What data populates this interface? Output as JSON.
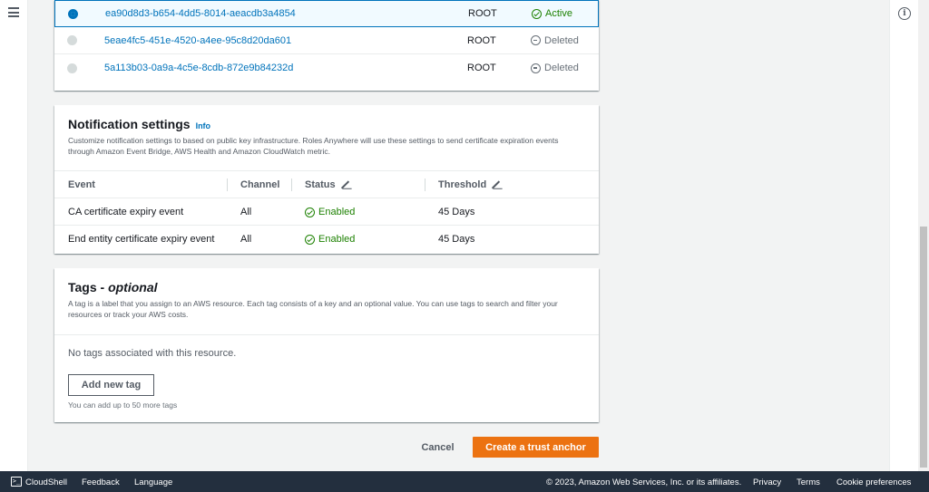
{
  "certificates": {
    "rows": [
      {
        "id": "ea90d8d3-b654-4dd5-8014-aeacdb3a4854",
        "type": "ROOT",
        "status": "Active",
        "selected": true
      },
      {
        "id": "5eae4fc5-451e-4520-a4ee-95c8d20da601",
        "type": "ROOT",
        "status": "Deleted",
        "selected": false
      },
      {
        "id": "5a113b03-0a9a-4c5e-8cdb-872e9b84232d",
        "type": "ROOT",
        "status": "Deleted",
        "selected": false
      }
    ]
  },
  "notification": {
    "title": "Notification settings",
    "info": "Info",
    "description": "Customize notification settings to based on public key infrastructure. Roles Anywhere will use these settings to send certificate expiration events through Amazon Event Bridge, AWS Health and Amazon CloudWatch metric.",
    "headers": {
      "event": "Event",
      "channel": "Channel",
      "status": "Status",
      "threshold": "Threshold"
    },
    "rows": [
      {
        "event": "CA certificate expiry event",
        "channel": "All",
        "status": "Enabled",
        "threshold": "45 Days"
      },
      {
        "event": "End entity certificate expiry event",
        "channel": "All",
        "status": "Enabled",
        "threshold": "45 Days"
      }
    ]
  },
  "tags": {
    "title": "Tags - ",
    "title_optional": "optional",
    "description": "A tag is a label that you assign to an AWS resource. Each tag consists of a key and an optional value. You can use tags to search and filter your resources or track your AWS costs.",
    "empty": "No tags associated with this resource.",
    "add_button": "Add new tag",
    "hint": "You can add up to 50 more tags"
  },
  "actions": {
    "cancel": "Cancel",
    "create": "Create a trust anchor"
  },
  "footer": {
    "cloudshell": "CloudShell",
    "feedback": "Feedback",
    "language": "Language",
    "copyright": "© 2023, Amazon Web Services, Inc. or its affiliates.",
    "privacy": "Privacy",
    "terms": "Terms",
    "cookies": "Cookie preferences"
  },
  "colors": {
    "accent": "#0073bb",
    "primary_button": "#ec7211",
    "success": "#1d8102",
    "footer_bg": "#232f3e"
  },
  "icons": {
    "menu": "hamburger-icon",
    "info": "info-icon",
    "active": "check-circle-icon",
    "deleted": "minus-circle-icon",
    "edit": "pencil-icon",
    "cloudshell": "terminal-icon"
  }
}
